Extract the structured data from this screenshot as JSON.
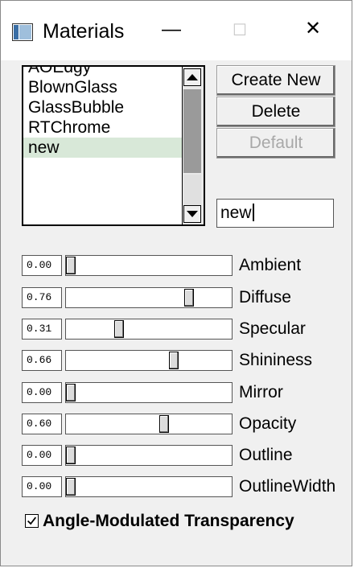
{
  "window": {
    "title": "Materials",
    "minimize_glyph": "—",
    "maximize_glyph": "☐",
    "close_glyph": "✕",
    "icon": "app-window-icon"
  },
  "materials_list": {
    "items": [
      {
        "label": "AOEdgy"
      },
      {
        "label": "BlownGlass"
      },
      {
        "label": "GlassBubble"
      },
      {
        "label": "RTChrome"
      },
      {
        "label": "new"
      }
    ],
    "selected": "new"
  },
  "buttons": {
    "create_new": "Create New",
    "delete": "Delete",
    "default": "Default"
  },
  "name_field": {
    "value": "new"
  },
  "sliders": [
    {
      "label": "Ambient",
      "value": "0.00",
      "fraction": 0.0
    },
    {
      "label": "Diffuse",
      "value": "0.76",
      "fraction": 0.76
    },
    {
      "label": "Specular",
      "value": "0.31",
      "fraction": 0.31
    },
    {
      "label": "Shininess",
      "value": "0.66",
      "fraction": 0.66
    },
    {
      "label": "Mirror",
      "value": "0.00",
      "fraction": 0.0
    },
    {
      "label": "Opacity",
      "value": "0.60",
      "fraction": 0.6
    },
    {
      "label": "Outline",
      "value": "0.00",
      "fraction": 0.0
    },
    {
      "label": "OutlineWidth",
      "value": "0.00",
      "fraction": 0.0
    }
  ],
  "angle_modulated": {
    "label": "Angle-Modulated Transparency",
    "checked": true
  },
  "colors": {
    "selection": "#d8e8d8",
    "scroll_thumb": "#9a9a9a"
  }
}
